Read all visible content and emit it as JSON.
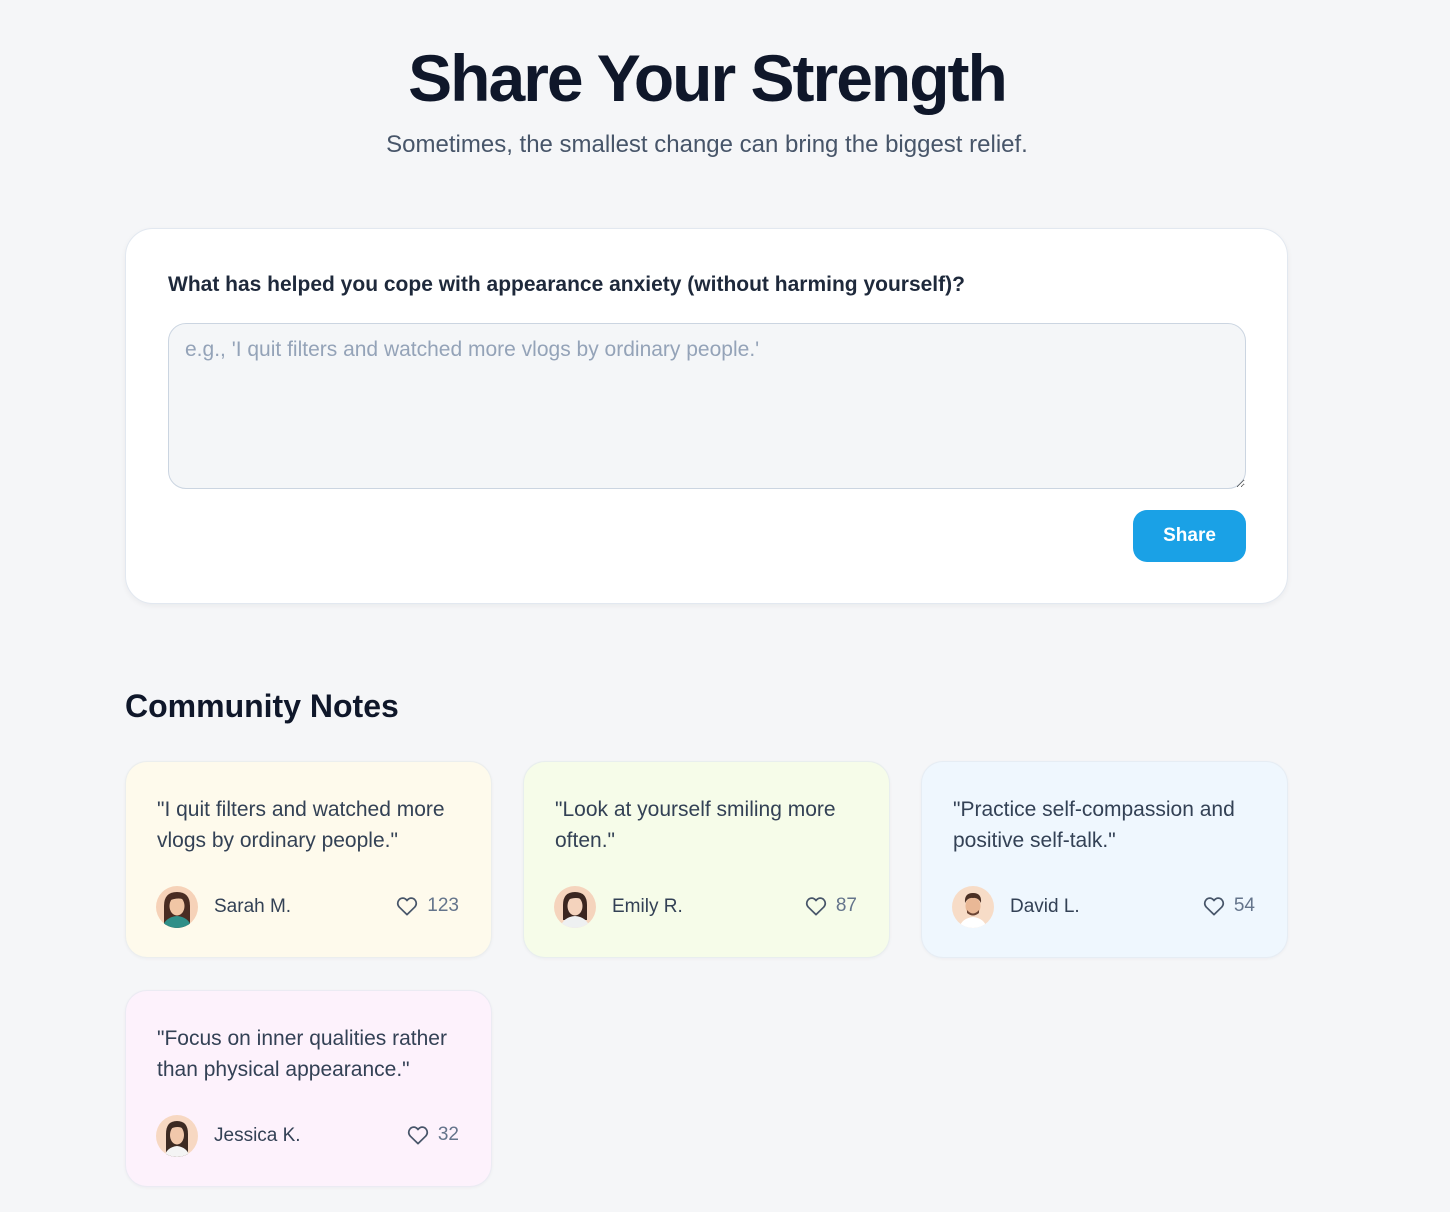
{
  "hero": {
    "title": "Share Your Strength",
    "subtitle": "Sometimes, the smallest change can bring the biggest relief."
  },
  "share_form": {
    "question": "What has helped you cope with appearance anxiety (without harming yourself)?",
    "input_value": "",
    "placeholder": "e.g., 'I quit filters and watched more vlogs by ordinary people.'",
    "button_label": "Share",
    "button_color": "#1aa1e6"
  },
  "community": {
    "title": "Community Notes",
    "notes": [
      {
        "text": "\"I quit filters and watched more vlogs by ordinary people.\"",
        "author": "Sarah M.",
        "likes": "123",
        "background": "#fefaec",
        "avatar_icon": "woman-avatar-icon",
        "like_icon": "heart-icon"
      },
      {
        "text": "\"Look at yourself smiling more often.\"",
        "author": "Emily R.",
        "likes": "87",
        "background": "#f6fce9",
        "avatar_icon": "woman-avatar-icon",
        "like_icon": "heart-icon"
      },
      {
        "text": "\"Practice self-compassion and positive self-talk.\"",
        "author": "David L.",
        "likes": "54",
        "background": "#eff7fe",
        "avatar_icon": "man-avatar-icon",
        "like_icon": "heart-icon"
      },
      {
        "text": "\"Focus on inner qualities rather than physical appearance.\"",
        "author": "Jessica K.",
        "likes": "32",
        "background": "#fdf2fc",
        "avatar_icon": "woman-avatar-icon",
        "like_icon": "heart-icon"
      }
    ]
  }
}
